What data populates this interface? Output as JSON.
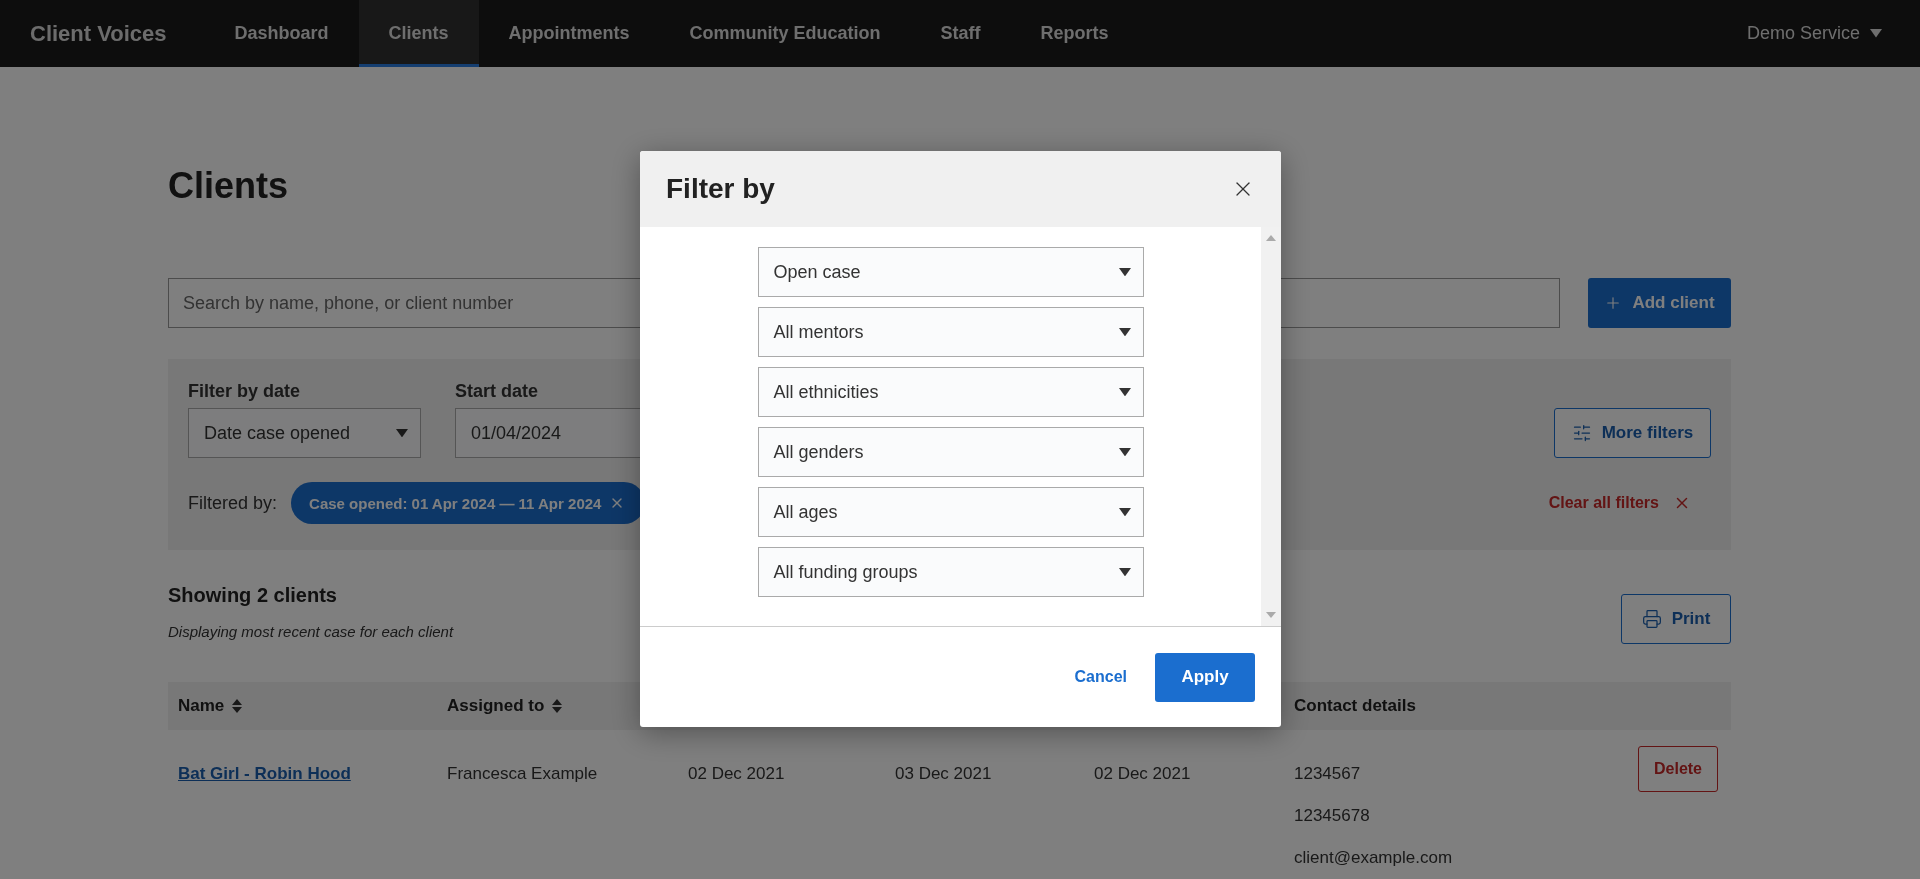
{
  "nav": {
    "brand": "Client Voices",
    "items": [
      {
        "label": "Dashboard",
        "selected": false
      },
      {
        "label": "Clients",
        "selected": true
      },
      {
        "label": "Appointments",
        "selected": false
      },
      {
        "label": "Community Education",
        "selected": false
      },
      {
        "label": "Staff",
        "selected": false
      },
      {
        "label": "Reports",
        "selected": false
      }
    ],
    "account": "Demo Service"
  },
  "page": {
    "title": "Clients",
    "search": {
      "placeholder": "Search by name, phone, or client number"
    },
    "add_button": "Add client",
    "filters": {
      "date_filter": {
        "label": "Filter by date",
        "value": "Date case opened"
      },
      "start_date": {
        "label": "Start date",
        "value": "01/04/2024"
      },
      "more_filters": "More filters",
      "filtered_by_label": "Filtered by:",
      "chips": [
        {
          "label": "Case opened: 01 Apr 2024 — 11 Apr 2024"
        }
      ],
      "clear_all": "Clear all filters"
    },
    "results": {
      "heading": "Showing 2 clients",
      "note": "Displaying most recent case for each client",
      "print": "Print"
    },
    "table": {
      "columns": [
        {
          "label": "Name",
          "sortable": true
        },
        {
          "label": "Assigned to",
          "sortable": true
        },
        {},
        {},
        {},
        {
          "label": "Contact details",
          "sortable": false
        }
      ],
      "rows": [
        {
          "cells": [
            {
              "kind": "link",
              "text": "Bat Girl - Robin Hood"
            },
            {
              "kind": "text",
              "text": "Francesca Example"
            },
            {
              "kind": "text",
              "text": "02 Dec 2021"
            },
            {
              "kind": "text",
              "text": "03 Dec 2021"
            },
            {
              "kind": "text",
              "text": "02 Dec 2021"
            },
            {
              "kind": "lines",
              "lines": [
                "1234567",
                "12345678",
                "client@example.com"
              ]
            }
          ],
          "action": "Delete"
        }
      ]
    }
  },
  "modal": {
    "title": "Filter by",
    "selects": [
      {
        "value": "Open case"
      },
      {
        "value": "All mentors"
      },
      {
        "value": "All ethnicities"
      },
      {
        "value": "All genders"
      },
      {
        "value": "All ages"
      },
      {
        "value": "All funding groups"
      }
    ],
    "cancel": "Cancel",
    "apply": "Apply"
  }
}
